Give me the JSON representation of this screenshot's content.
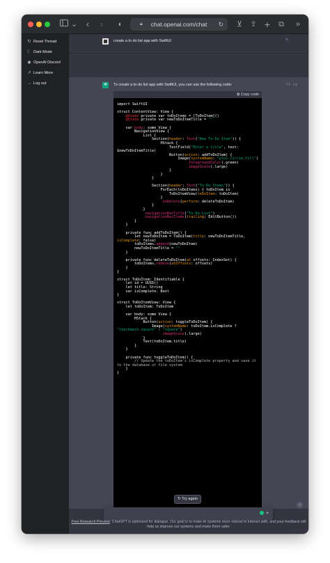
{
  "browser": {
    "url": "chat.openai.com/chat",
    "lock_icon": "lock-icon",
    "reload_icon": "reload-icon"
  },
  "sidebar": {
    "items": [
      {
        "label": "Reset Thread",
        "icon": "reset-icon",
        "glyph": "↻"
      },
      {
        "label": "Dark Mode",
        "icon": "moon-icon",
        "glyph": "☾"
      },
      {
        "label": "OpenAI Discord",
        "icon": "discord-icon",
        "glyph": "◉"
      },
      {
        "label": "Learn More",
        "icon": "external-link-icon",
        "glyph": "↗"
      },
      {
        "label": "Log out",
        "icon": "logout-icon",
        "glyph": "→"
      }
    ]
  },
  "conversation": {
    "user_message": "create a to do list app with SwiftUI",
    "assistant_intro": "To create a to-do list app with SwiftUI, you can use the following code:",
    "copy_label": "Copy code",
    "code_lines": [
      [
        {
          "t": "import SwiftUI"
        }
      ],
      [],
      [
        {
          "t": "struct ContentView: View {"
        }
      ],
      [
        {
          "t": "    "
        },
        {
          "t": "@State",
          "c": "kw"
        },
        {
          "t": " private var toDoItems = [ToDoItem]()"
        }
      ],
      [
        {
          "t": "    "
        },
        {
          "t": "@State",
          "c": "kw"
        },
        {
          "t": " private var newToDoItemTitle = "
        },
        {
          "t": "\"\"",
          "c": "str"
        }
      ],
      [],
      [
        {
          "t": "    var "
        },
        {
          "t": "body",
          "c": "fn"
        },
        {
          "t": ": some View {"
        }
      ],
      [
        {
          "t": "        NavigationView {"
        }
      ],
      [
        {
          "t": "            List {"
        }
      ],
      [
        {
          "t": "                Section("
        },
        {
          "t": "header",
          "c": "param"
        },
        {
          "t": ": "
        },
        {
          "t": "Text",
          "c": "fn"
        },
        {
          "t": "("
        },
        {
          "t": "\"New To-Do Item\"",
          "c": "str"
        },
        {
          "t": ")) {"
        }
      ],
      [
        {
          "t": "                    HStack {"
        }
      ],
      [
        {
          "t": "                        TextField("
        },
        {
          "t": "\"Enter a title\"",
          "c": "str"
        },
        {
          "t": ", text:"
        }
      ],
      [
        {
          "t": "$newToDoItemTitle)"
        }
      ],
      [
        {
          "t": "                        Button("
        },
        {
          "t": "action",
          "c": "param"
        },
        {
          "t": ": addToDoItem) {"
        }
      ],
      [
        {
          "t": "                            Image("
        },
        {
          "t": "systemName",
          "c": "param"
        },
        {
          "t": ": "
        },
        {
          "t": "\"plus.circle.fill\"",
          "c": "str"
        },
        {
          "t": ")"
        }
      ],
      [
        {
          "t": "                                "
        },
        {
          "t": ".foregroundColor",
          "c": "fn"
        },
        {
          "t": "(.green)"
        }
      ],
      [
        {
          "t": "                                "
        },
        {
          "t": ".imageScale",
          "c": "fn"
        },
        {
          "t": "(.large)"
        }
      ],
      [
        {
          "t": "                        }"
        }
      ],
      [
        {
          "t": "                    }"
        }
      ],
      [
        {
          "t": "                }"
        }
      ],
      [],
      [
        {
          "t": "                Section("
        },
        {
          "t": "header",
          "c": "param"
        },
        {
          "t": ": "
        },
        {
          "t": "Text",
          "c": "fn"
        },
        {
          "t": "("
        },
        {
          "t": "\"To-Do Items\"",
          "c": "str"
        },
        {
          "t": ")) {"
        }
      ],
      [
        {
          "t": "                    ForEach(toDoItems) { toDoItem in"
        }
      ],
      [
        {
          "t": "                        ToDoItemView("
        },
        {
          "t": "toDoItem",
          "c": "param"
        },
        {
          "t": ": toDoItem)"
        }
      ],
      [
        {
          "t": "                    }"
        }
      ],
      [
        {
          "t": "                    "
        },
        {
          "t": ".onDelete",
          "c": "fn"
        },
        {
          "t": "("
        },
        {
          "t": "perform",
          "c": "param"
        },
        {
          "t": ": deleteToDoItem)"
        }
      ],
      [
        {
          "t": "                }"
        }
      ],
      [
        {
          "t": "            }"
        }
      ],
      [
        {
          "t": "            "
        },
        {
          "t": ".navigationBarTitle",
          "c": "fn"
        },
        {
          "t": "("
        },
        {
          "t": "\"To-Do List\"",
          "c": "str"
        },
        {
          "t": ")"
        }
      ],
      [
        {
          "t": "            "
        },
        {
          "t": ".navigationBarItems",
          "c": "fn"
        },
        {
          "t": "("
        },
        {
          "t": "trailing",
          "c": "param"
        },
        {
          "t": ": EditButton())"
        }
      ],
      [
        {
          "t": "        }"
        }
      ],
      [
        {
          "t": "    }"
        }
      ],
      [],
      [
        {
          "t": "    private func addToDoItem() {"
        }
      ],
      [
        {
          "t": "        let newToDoItem = ToDoItem("
        },
        {
          "t": "title",
          "c": "param"
        },
        {
          "t": ": newToDoItemTitle,"
        }
      ],
      [
        {
          "t": "isComplete",
          "c": "param"
        },
        {
          "t": ": false)"
        }
      ],
      [
        {
          "t": "        toDoItems."
        },
        {
          "t": "append",
          "c": "fn"
        },
        {
          "t": "(newToDoItem)"
        }
      ],
      [
        {
          "t": "        newToDoItemTitle = "
        },
        {
          "t": "\"\"",
          "c": "str"
        }
      ],
      [
        {
          "t": "    }"
        }
      ],
      [],
      [
        {
          "t": "    private func deleteToDoItem("
        },
        {
          "t": "at",
          "c": "param"
        },
        {
          "t": " offsets: IndexSet) {"
        }
      ],
      [
        {
          "t": "        toDoItems."
        },
        {
          "t": "remove",
          "c": "fn"
        },
        {
          "t": "("
        },
        {
          "t": "atOffsets",
          "c": "param"
        },
        {
          "t": ": offsets)"
        }
      ],
      [
        {
          "t": "    }"
        }
      ],
      [
        {
          "t": "}"
        }
      ],
      [],
      [
        {
          "t": "struct ToDoItem: Identifiable {"
        }
      ],
      [
        {
          "t": "    let id = UUID()"
        }
      ],
      [
        {
          "t": "    let title: String"
        }
      ],
      [
        {
          "t": "    var isComplete: Bool"
        }
      ],
      [
        {
          "t": "}"
        }
      ],
      [],
      [
        {
          "t": "struct ToDoItemView: View {"
        }
      ],
      [
        {
          "t": "    let toDoItem: ToDoItem"
        }
      ],
      [],
      [
        {
          "t": "    var body: some View {"
        }
      ],
      [
        {
          "t": "        HStack {"
        }
      ],
      [
        {
          "t": "            Button("
        },
        {
          "t": "action",
          "c": "param"
        },
        {
          "t": ": toggleToDoItem) {"
        }
      ],
      [
        {
          "t": "                Image("
        },
        {
          "t": "systemName",
          "c": "param"
        },
        {
          "t": ": toDoItem.isComplete ?"
        }
      ],
      [
        {
          "t": "\"checkmark.square\"",
          "c": "str"
        },
        {
          "t": " : "
        },
        {
          "t": "\"square\"",
          "c": "str"
        },
        {
          "t": ")"
        }
      ],
      [
        {
          "t": "                    "
        },
        {
          "t": ".imageScale",
          "c": "fn"
        },
        {
          "t": "(.large)"
        }
      ],
      [
        {
          "t": "            }"
        }
      ],
      [
        {
          "t": "            Text(toDoItem.title)"
        }
      ],
      [
        {
          "t": "        }"
        }
      ],
      [
        {
          "t": "    }"
        }
      ],
      [],
      [
        {
          "t": "    private func toggleToDoItem() {"
        }
      ],
      [
        {
          "t": "        // Update the toDoItem's isComplete property and save it",
          "c": "cmt"
        }
      ],
      [
        {
          "t": "to the database or file system",
          "c": "cmt"
        }
      ],
      [
        {
          "t": "    }"
        }
      ],
      [
        {
          "t": "}"
        }
      ]
    ]
  },
  "actions": {
    "try_again": "Try again",
    "try_again_icon": "refresh-icon"
  },
  "input": {
    "placeholder": "",
    "send_icon": "send-icon"
  },
  "footer": {
    "link": "Free Research Preview",
    "text": ": ChatGPT is optimized for dialogue. Our goal is to make AI systems more natural to interact with, and your feedback will help us improve our systems and make them safer."
  },
  "colors": {
    "sidebar_bg": "#202123",
    "chat_bg": "#343541",
    "assistant_bg": "#444654",
    "brand": "#10a37f",
    "code_keyword": "#f22c3d",
    "code_string": "#00a67d",
    "code_function": "#df3079",
    "code_param": "#e9950c"
  }
}
